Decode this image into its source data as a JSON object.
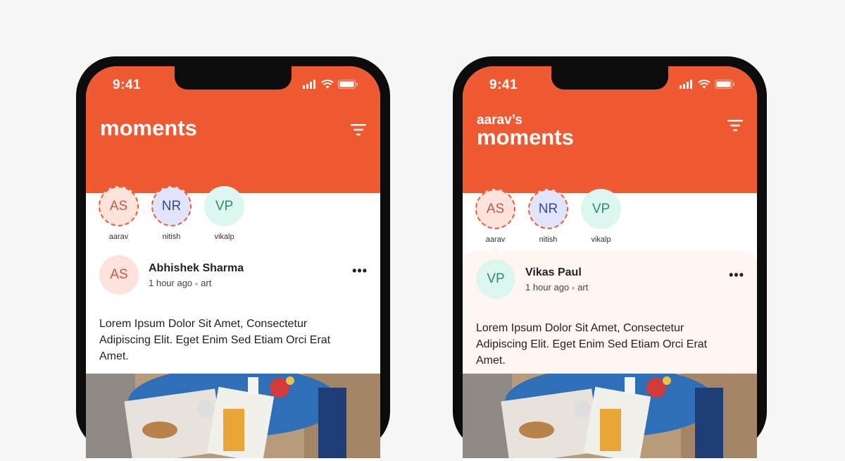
{
  "colors": {
    "brand": "#f05a33",
    "background": "#f6f6f6"
  },
  "screens": [
    {
      "status": {
        "time": "9:41",
        "icons": [
          "signal-icon",
          "wifi-icon",
          "battery-icon"
        ]
      },
      "header": {
        "subtitle": "",
        "title": "moments",
        "filter_icon": "filter-icon"
      },
      "stories": [
        {
          "initials": "AS",
          "label": "aarav"
        },
        {
          "initials": "NR",
          "label": "nitish"
        },
        {
          "initials": "VP",
          "label": "vikalp"
        }
      ],
      "post": {
        "initials": "AS",
        "author": "Abhishek Sharma",
        "time": "1 hour ago",
        "tag": "art",
        "more_icon": "more-icon",
        "text": "Lorem Ipsum Dolor Sit Amet, Consectetur Adipiscing Elit. Eget Enim Sed Etiam Orci Erat Amet."
      }
    },
    {
      "status": {
        "time": "9:41",
        "icons": [
          "signal-icon",
          "wifi-icon",
          "battery-icon"
        ]
      },
      "header": {
        "subtitle": "aarav’s",
        "title": "moments",
        "filter_icon": "filter-icon"
      },
      "stories": [
        {
          "initials": "AS",
          "label": "aarav"
        },
        {
          "initials": "NR",
          "label": "nitish"
        },
        {
          "initials": "VP",
          "label": "vikalp"
        }
      ],
      "post": {
        "initials": "VP",
        "author": "Vikas Paul",
        "time": "1 hour ago",
        "tag": "art",
        "more_icon": "more-icon",
        "text": "Lorem Ipsum Dolor Sit Amet, Consectetur Adipiscing Elit. Eget Enim Sed Etiam Orci Erat Amet."
      }
    }
  ]
}
